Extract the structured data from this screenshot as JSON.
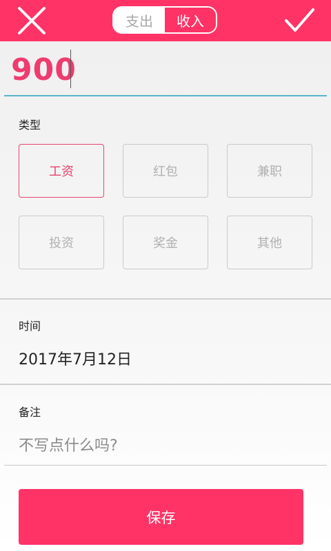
{
  "header": {
    "tabs": [
      {
        "label": "支出",
        "active": false
      },
      {
        "label": "收入",
        "active": true
      }
    ],
    "close_icon": "close-icon",
    "confirm_icon": "check-icon",
    "accent_color": "#ff3366"
  },
  "amount": {
    "value": "900"
  },
  "type_section": {
    "label": "类型",
    "categories": [
      "工资",
      "红包",
      "兼职",
      "投资",
      "奖金",
      "其他"
    ],
    "selected": "工资"
  },
  "time_section": {
    "label": "时间",
    "value": "2017年7月12日"
  },
  "note_section": {
    "label": "备注",
    "placeholder": "不写点什么吗?"
  },
  "save_button": {
    "label": "保存"
  }
}
